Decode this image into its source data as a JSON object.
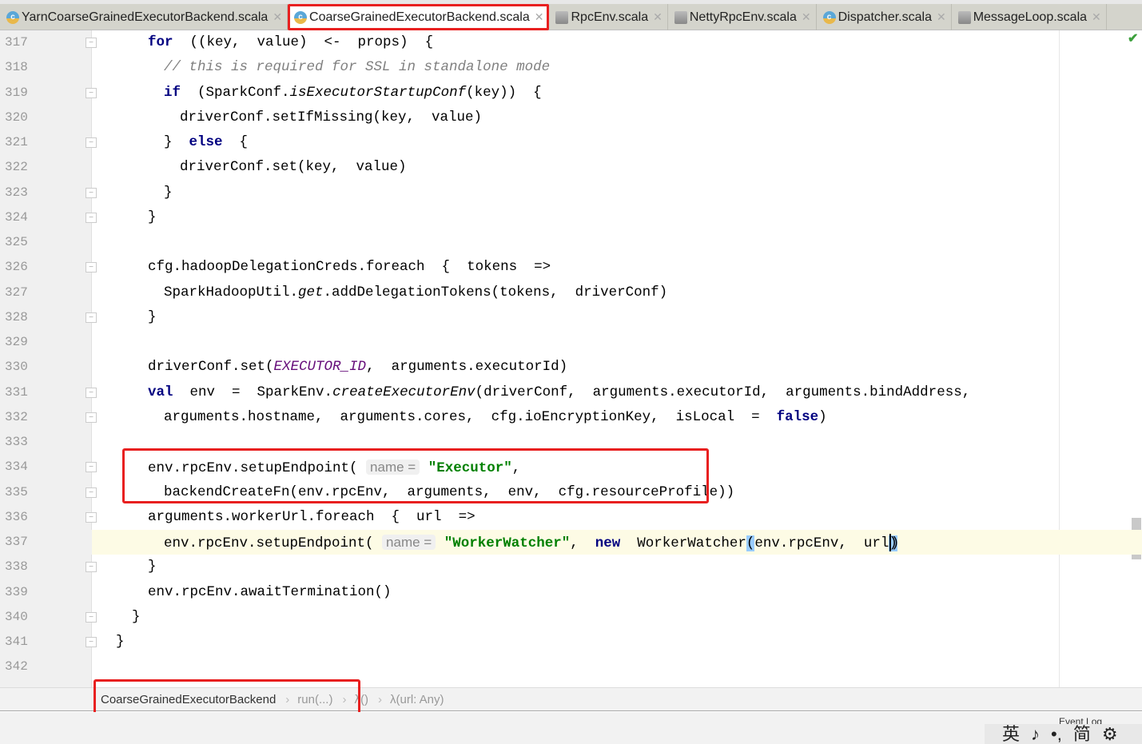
{
  "tabs": [
    {
      "label": "YarnCoarseGrainedExecutorBackend.scala",
      "icon": "scala-class-icon",
      "active": false
    },
    {
      "label": "CoarseGrainedExecutorBackend.scala",
      "icon": "scala-class-icon",
      "active": true
    },
    {
      "label": "RpcEnv.scala",
      "icon": "scala-object-icon",
      "active": false
    },
    {
      "label": "NettyRpcEnv.scala",
      "icon": "scala-object-icon",
      "active": false
    },
    {
      "label": "Dispatcher.scala",
      "icon": "scala-class-icon",
      "active": false
    },
    {
      "label": "MessageLoop.scala",
      "icon": "scala-object-icon",
      "active": false
    }
  ],
  "code": {
    "lines": [
      {
        "n": "317",
        "ind": 2,
        "fold": "open",
        "t": [
          [
            "k",
            "for"
          ],
          [
            "",
            "  ((key,  value)  <-  props)  {"
          ]
        ]
      },
      {
        "n": "318",
        "ind": 3,
        "t": [
          [
            "c",
            "// this is required for SSL in standalone mode"
          ]
        ]
      },
      {
        "n": "319",
        "ind": 3,
        "fold": "open",
        "t": [
          [
            "k",
            "if"
          ],
          [
            "",
            "  (SparkConf."
          ],
          [
            "i",
            "isExecutorStartupConf"
          ],
          [
            "",
            "(key))  {"
          ]
        ]
      },
      {
        "n": "320",
        "ind": 4,
        "t": [
          [
            "",
            "driverConf.setIfMissing(key,  value)"
          ]
        ]
      },
      {
        "n": "321",
        "ind": 3,
        "fold": "close",
        "t": [
          [
            "",
            "}  "
          ],
          [
            "k",
            "else"
          ],
          [
            "",
            "  {"
          ]
        ]
      },
      {
        "n": "322",
        "ind": 4,
        "t": [
          [
            "",
            "driverConf.set(key,  value)"
          ]
        ]
      },
      {
        "n": "323",
        "ind": 3,
        "fold": "close",
        "t": [
          [
            "",
            "}"
          ]
        ]
      },
      {
        "n": "324",
        "ind": 2,
        "fold": "close",
        "t": [
          [
            "",
            "}"
          ]
        ]
      },
      {
        "n": "325",
        "ind": 2,
        "t": []
      },
      {
        "n": "326",
        "ind": 2,
        "fold": "open",
        "t": [
          [
            "",
            "cfg.hadoopDelegationCreds.foreach  {  tokens  =>"
          ]
        ]
      },
      {
        "n": "327",
        "ind": 3,
        "t": [
          [
            "",
            "SparkHadoopUtil."
          ],
          [
            "i",
            "get"
          ],
          [
            "",
            ".addDelegationTokens(tokens,  driverConf)"
          ]
        ]
      },
      {
        "n": "328",
        "ind": 2,
        "fold": "close",
        "t": [
          [
            "",
            "}"
          ]
        ]
      },
      {
        "n": "329",
        "ind": 2,
        "t": []
      },
      {
        "n": "330",
        "ind": 2,
        "t": [
          [
            "",
            "driverConf.set("
          ],
          [
            "ic",
            "EXECUTOR_ID"
          ],
          [
            "",
            ",  arguments.executorId)"
          ]
        ]
      },
      {
        "n": "331",
        "ind": 2,
        "fold": "open",
        "t": [
          [
            "k",
            "val"
          ],
          [
            "",
            "  env  =  SparkEnv."
          ],
          [
            "i",
            "createExecutorEnv"
          ],
          [
            "",
            "(driverConf,  arguments.executorId,  arguments.bindAddress,"
          ]
        ]
      },
      {
        "n": "332",
        "ind": 3,
        "fold": "close",
        "t": [
          [
            "",
            "arguments.hostname,  arguments.cores,  cfg.ioEncryptionKey,  isLocal  =  "
          ],
          [
            "k",
            "false"
          ],
          [
            "",
            ")"
          ]
        ]
      },
      {
        "n": "333",
        "ind": 2,
        "t": []
      },
      {
        "n": "334",
        "ind": 2,
        "fold": "open",
        "t": [
          [
            "",
            "env.rpcEnv.setupEndpoint( "
          ],
          [
            "h",
            "name ="
          ],
          [
            "s",
            " \"Executor\""
          ],
          [
            "",
            ","
          ]
        ]
      },
      {
        "n": "335",
        "ind": 3,
        "fold": "close",
        "t": [
          [
            "",
            "backendCreateFn(env.rpcEnv,  arguments,  env,  cfg.resourceProfile))"
          ]
        ]
      },
      {
        "n": "336",
        "ind": 2,
        "fold": "open",
        "t": [
          [
            "",
            "arguments.workerUrl.foreach  {  url  =>"
          ]
        ]
      },
      {
        "n": "337",
        "ind": 3,
        "cur": true,
        "t": [
          [
            "",
            "env.rpcEnv.setupEndpoint( "
          ],
          [
            "h",
            "name ="
          ],
          [
            "s",
            " \"WorkerWatcher\""
          ],
          [
            "",
            ",  "
          ],
          [
            "k",
            "new"
          ],
          [
            "",
            "  WorkerWatcher"
          ],
          [
            "br",
            "("
          ],
          [
            "",
            "env.rpcEnv,  url"
          ],
          [
            "br",
            ")"
          ],
          [
            "",
            ")"
          ]
        ]
      },
      {
        "n": "338",
        "ind": 2,
        "fold": "close",
        "t": [
          [
            "",
            "}"
          ]
        ]
      },
      {
        "n": "339",
        "ind": 2,
        "t": [
          [
            "",
            "env.rpcEnv.awaitTermination()"
          ]
        ]
      },
      {
        "n": "340",
        "ind": 1,
        "fold": "close",
        "t": [
          [
            "",
            "}"
          ]
        ]
      },
      {
        "n": "341",
        "ind": 0,
        "fold": "close",
        "t": [
          [
            "",
            "}"
          ]
        ]
      },
      {
        "n": "342",
        "ind": 0,
        "t": []
      }
    ]
  },
  "breadcrumb": [
    "CoarseGrainedExecutorBackend",
    "run(...)",
    "λ()",
    "λ(url: Any)"
  ],
  "status": {
    "event_log": "Event Log",
    "ime": [
      "英",
      "♪",
      "•,",
      "简",
      "⚙"
    ]
  },
  "colors": {
    "keyword": "#000080",
    "string": "#008000",
    "comment": "#808080",
    "highlight_box": "#e82020",
    "current_line": "#fdfbe5"
  }
}
